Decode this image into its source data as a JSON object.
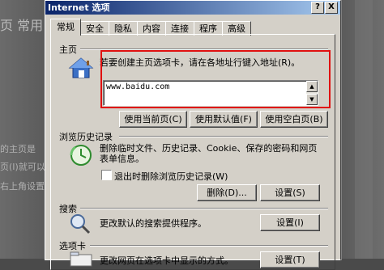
{
  "background": {
    "left_texts": [
      "页 常用",
      "的主页是",
      "页(I)就可以",
      "右上角设置"
    ]
  },
  "titlebar": {
    "title": "Internet 选项",
    "help": "?",
    "close": "X"
  },
  "tabs": [
    "常规",
    "安全",
    "隐私",
    "内容",
    "连接",
    "程序",
    "高级"
  ],
  "home": {
    "section": "主页",
    "instruction": "若要创建主页选项卡，请在各地址行键入地址(R)。",
    "url": "www.baidu.com",
    "buttons": [
      "使用当前页(C)",
      "使用默认值(F)",
      "使用空白页(B)"
    ]
  },
  "history": {
    "section": "浏览历史记录",
    "description": "删除临时文件、历史记录、Cookie、保存的密码和网页表单信息。",
    "checkbox_label": "退出时删除浏览历史记录(W)",
    "delete_button": "删除(D)...",
    "settings_button": "设置(S)"
  },
  "search": {
    "section": "搜索",
    "description": "更改默认的搜索提供程序。",
    "settings_button": "设置(I)"
  },
  "tabsection": {
    "section": "选项卡",
    "description": "更改网页在选项卡中显示的方式。",
    "settings_button": "设置(T)"
  },
  "colors": {
    "title_start": "#0a246a",
    "title_end": "#a6caf0",
    "highlight": "#e01010",
    "dialog": "#d4d0c8"
  }
}
